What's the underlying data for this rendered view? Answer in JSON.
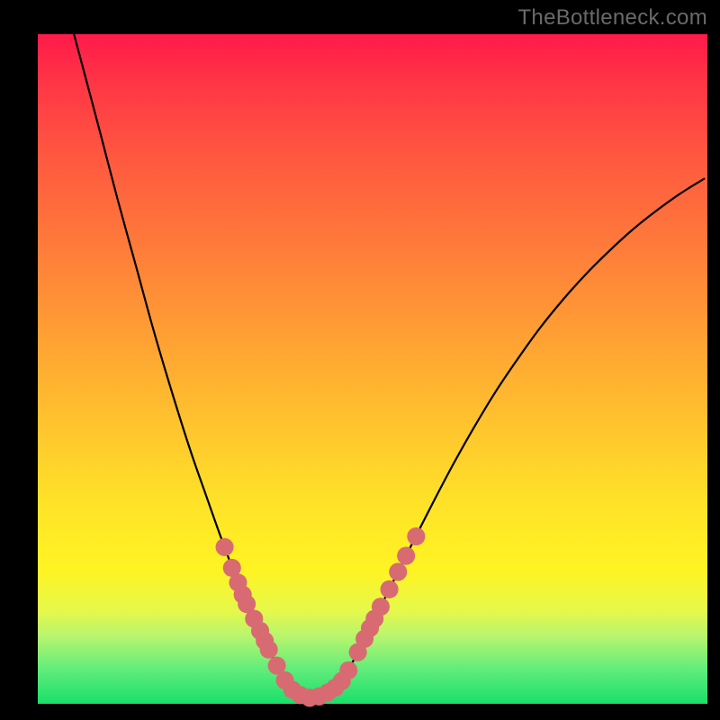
{
  "watermark": "TheBottleneck.com",
  "colors": {
    "frame": "#000000",
    "curve": "#000000",
    "dot_fill": "#d86b72",
    "dot_stroke": "#d86b72"
  },
  "chart_data": {
    "type": "line",
    "title": "",
    "xlabel": "",
    "ylabel": "",
    "xlim": [
      0,
      100
    ],
    "ylim": [
      0,
      100
    ],
    "note": "No numeric axes are rendered; values are normalized 0–100 in plot-area coordinates (origin top-left, y downward).",
    "series": [
      {
        "name": "left-branch",
        "x": [
          5.4,
          7.3,
          9.5,
          11.9,
          14.6,
          17.4,
          20.2,
          22.8,
          25.1,
          26.9,
          28.3,
          29.4,
          30.4,
          31.3,
          32.2,
          33.1,
          33.9,
          34.6,
          35.4,
          36.5
        ],
        "y": [
          0.0,
          7.1,
          15.4,
          24.6,
          34.4,
          44.6,
          54.0,
          62.2,
          68.8,
          73.9,
          77.7,
          80.7,
          83.1,
          85.2,
          87.1,
          88.9,
          90.6,
          92.0,
          93.6,
          95.8
        ]
      },
      {
        "name": "valley",
        "x": [
          36.5,
          37.4,
          38.4,
          39.5,
          40.6,
          41.8,
          43.0,
          44.1,
          45.0,
          45.7
        ],
        "y": [
          95.8,
          97.2,
          98.2,
          98.8,
          99.1,
          99.0,
          98.6,
          97.9,
          97.1,
          96.2
        ]
      },
      {
        "name": "right-branch",
        "x": [
          45.7,
          47.0,
          48.7,
          50.8,
          53.3,
          56.1,
          59.0,
          62.0,
          65.1,
          68.3,
          71.6,
          74.9,
          78.3,
          81.7,
          85.2,
          88.7,
          92.2,
          95.8,
          99.5
        ],
        "y": [
          96.2,
          93.8,
          90.5,
          86.3,
          81.3,
          75.7,
          70.0,
          64.3,
          58.8,
          53.5,
          48.6,
          44.0,
          39.8,
          36.0,
          32.5,
          29.3,
          26.5,
          23.9,
          21.6
        ]
      }
    ],
    "dots": {
      "name": "highlighted-points",
      "radius_pct": 1.35,
      "points": [
        {
          "x": 27.9,
          "y": 76.6
        },
        {
          "x": 29.0,
          "y": 79.7
        },
        {
          "x": 29.9,
          "y": 81.9
        },
        {
          "x": 30.6,
          "y": 83.7
        },
        {
          "x": 31.2,
          "y": 85.1
        },
        {
          "x": 32.3,
          "y": 87.3
        },
        {
          "x": 33.2,
          "y": 89.1
        },
        {
          "x": 33.9,
          "y": 90.6
        },
        {
          "x": 34.5,
          "y": 91.9
        },
        {
          "x": 35.7,
          "y": 94.3
        },
        {
          "x": 36.9,
          "y": 96.5
        },
        {
          "x": 38.0,
          "y": 97.9
        },
        {
          "x": 39.2,
          "y": 98.7
        },
        {
          "x": 40.6,
          "y": 99.1
        },
        {
          "x": 42.0,
          "y": 98.9
        },
        {
          "x": 43.3,
          "y": 98.3
        },
        {
          "x": 44.4,
          "y": 97.6
        },
        {
          "x": 45.4,
          "y": 96.6
        },
        {
          "x": 46.4,
          "y": 95.0
        },
        {
          "x": 47.8,
          "y": 92.3
        },
        {
          "x": 48.8,
          "y": 90.3
        },
        {
          "x": 49.6,
          "y": 88.7
        },
        {
          "x": 50.3,
          "y": 87.3
        },
        {
          "x": 51.2,
          "y": 85.5
        },
        {
          "x": 52.5,
          "y": 82.9
        },
        {
          "x": 53.8,
          "y": 80.3
        },
        {
          "x": 55.0,
          "y": 77.9
        },
        {
          "x": 56.5,
          "y": 75.0
        }
      ]
    }
  }
}
